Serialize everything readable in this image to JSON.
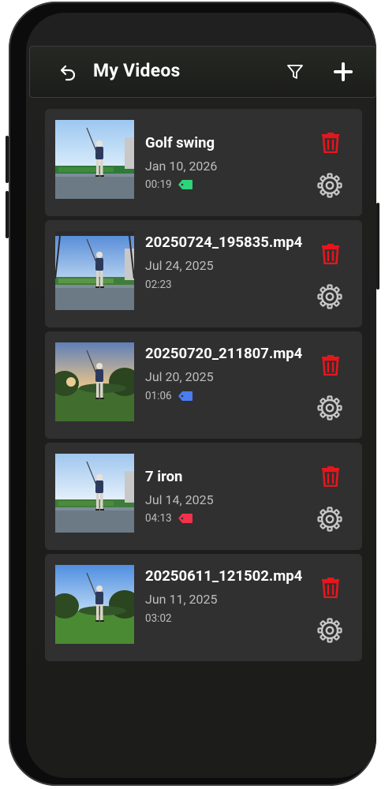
{
  "header": {
    "title": "My Videos",
    "back_icon": "back-arrow-icon",
    "filter_icon": "filter-icon",
    "add_icon": "plus-icon"
  },
  "videos": [
    {
      "name": "Golf swing",
      "date": "Jan 10, 2026",
      "duration": "00:19",
      "tag_color": "#2fd37a"
    },
    {
      "name": "20250724_195835.mp4",
      "date": "Jul 24, 2025",
      "duration": "02:23",
      "tag_color": ""
    },
    {
      "name": "20250720_211807.mp4",
      "date": "Jul 20, 2025",
      "duration": "01:06",
      "tag_color": "#4a7df0"
    },
    {
      "name": "7 iron",
      "date": "Jul 14, 2025",
      "duration": "04:13",
      "tag_color": "#f0324b"
    },
    {
      "name": "20250611_121502.mp4",
      "date": "Jun 11, 2025",
      "duration": "03:02",
      "tag_color": ""
    }
  ],
  "colors": {
    "delete": "#e5161d",
    "gear": "#c8c8c8",
    "card_bg": "#303030"
  }
}
